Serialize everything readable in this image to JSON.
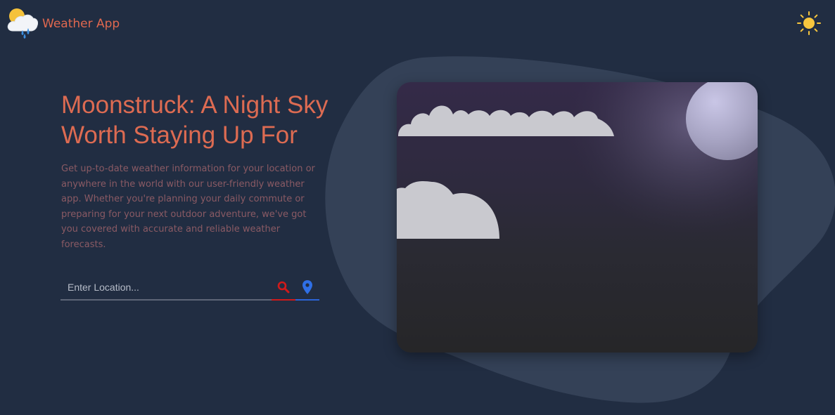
{
  "header": {
    "app_name": "Weather App",
    "logo_icon": "cloud-sun-rain-icon",
    "theme_toggle_icon": "sun-icon"
  },
  "hero": {
    "title": "Moonstruck: A Night Sky Worth Staying Up For",
    "description": "Get up-to-date weather information for your location or anywhere in the world with our user-friendly weather app. Whether you're planning your daily commute or preparing for your next outdoor adventure, we've got you covered with accurate and reliable weather forecasts."
  },
  "search": {
    "placeholder": "Enter Location...",
    "value": "",
    "search_icon": "search-icon",
    "location_icon": "location-pin-icon"
  },
  "scene": {
    "elements": [
      "moon",
      "cloud",
      "cloud"
    ]
  },
  "colors": {
    "background": "#212d42",
    "blob": "#344157",
    "accent": "#e0684f",
    "search_underline": "#d11a1a",
    "location_underline": "#2c64d6",
    "sun": "#f5c842"
  }
}
